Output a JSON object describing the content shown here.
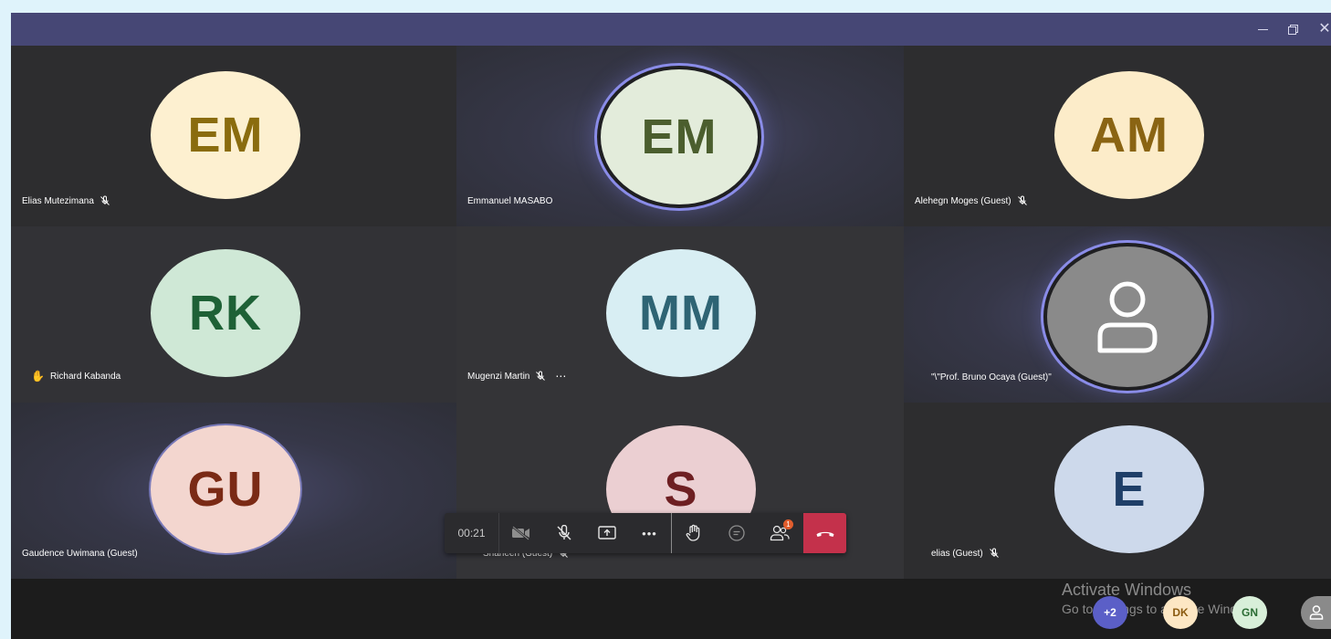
{
  "window": {
    "controls": {
      "minimize_icon": "minimize-icon",
      "restore_icon": "restore-icon",
      "close_icon": "close-icon"
    }
  },
  "participants": [
    {
      "initials": "EM",
      "name": "Elias Mutezimana",
      "muted": true,
      "bg": "#fdf0d0",
      "fg": "#8a6c0e"
    },
    {
      "initials": "EM",
      "name": "Emmanuel MASABO",
      "muted": false,
      "speaking": true,
      "bg": "#e3ecdb",
      "fg": "#4b5e2e"
    },
    {
      "initials": "AM",
      "name": "Alehegn Moges (Guest)",
      "muted": true,
      "bg": "#fcecc9",
      "fg": "#8a6413"
    },
    {
      "initials": "RK",
      "name": "Richard Kabanda",
      "hand_raised": true,
      "bg": "#cfe8d6",
      "fg": "#1e6136"
    },
    {
      "initials": "MM",
      "name": "Mugenzi Martin",
      "muted": true,
      "more_options": "⋯",
      "bg": "#d8eef3",
      "fg": "#2e6474"
    },
    {
      "initials": "",
      "name": "\"\\\"Prof. Bruno Ocaya (Guest)\"",
      "generic": true,
      "speaking": true
    },
    {
      "initials": "GU",
      "name": "Gaudence Uwimana (Guest)",
      "bg": "#f3d6cf",
      "fg": "#7a2a15"
    },
    {
      "initials": "S",
      "name": "Shaheen (Guest)",
      "muted": true,
      "bg": "#ebcfd2",
      "fg": "#6e1f22"
    },
    {
      "initials": "E",
      "name": "elias (Guest)",
      "muted": true,
      "bg": "#cdd9eb",
      "fg": "#1f3f68"
    }
  ],
  "toolbar": {
    "timer": "00:21",
    "buttons": [
      "camera-off-icon",
      "mic-off-icon",
      "share-screen-icon",
      "more-icon",
      "raise-hand-icon",
      "chat-icon",
      "participants-icon",
      "hang-up-icon"
    ],
    "participants_badge": "1",
    "more_label": "•••",
    "end_color": "#c4314b"
  },
  "watermark": {
    "line1": "Activate Windows",
    "line2": "Go to Settings to activate Windows."
  },
  "overflow": [
    {
      "label": "+2",
      "bg": "#5b5fc7",
      "fg": "#ffffff"
    },
    {
      "label": "DK",
      "bg": "#fde7c4",
      "fg": "#8a5a10"
    },
    {
      "label": "GN",
      "bg": "#d8efd9",
      "fg": "#2a6b33"
    }
  ]
}
